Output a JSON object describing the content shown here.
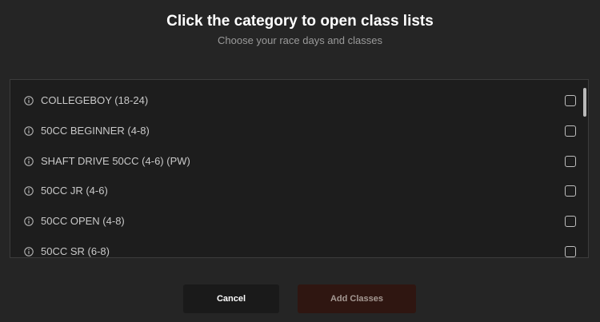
{
  "header": {
    "title": "Click the category to open class lists",
    "subtitle": "Choose your race days and classes"
  },
  "classes": [
    {
      "label": "COLLEGEBOY (18-24)",
      "checked": false
    },
    {
      "label": "50CC BEGINNER (4-8)",
      "checked": false
    },
    {
      "label": "SHAFT DRIVE 50CC (4-6) (PW)",
      "checked": false
    },
    {
      "label": "50CC JR (4-6)",
      "checked": false
    },
    {
      "label": "50CC OPEN (4-8)",
      "checked": false
    },
    {
      "label": "50CC SR (6-8)",
      "checked": false
    }
  ],
  "icons": {
    "item_icon": "info-icon"
  },
  "actions": {
    "cancel_label": "Cancel",
    "add_label": "Add Classes"
  },
  "colors": {
    "background": "#252525",
    "list_background": "#1d1d1d",
    "add_button": "#2f1611",
    "cancel_button": "#1a1a1a"
  }
}
